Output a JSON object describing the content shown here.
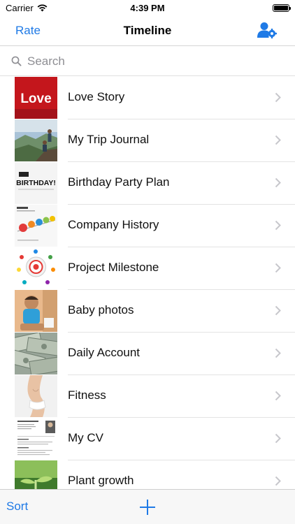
{
  "status": {
    "carrier": "Carrier",
    "time": "4:39 PM"
  },
  "nav": {
    "left_label": "Rate",
    "title": "Timeline",
    "right_icon": "user-settings-icon"
  },
  "search": {
    "placeholder": "Search"
  },
  "items": [
    {
      "label": "Love Story",
      "thumb_text": "Love"
    },
    {
      "label": "My Trip Journal"
    },
    {
      "label": "Birthday Party Plan",
      "thumb_text": "BIRTHDAY!"
    },
    {
      "label": "Company History"
    },
    {
      "label": "Project Milestone"
    },
    {
      "label": "Baby photos"
    },
    {
      "label": "Daily Account"
    },
    {
      "label": "Fitness"
    },
    {
      "label": "My CV"
    },
    {
      "label": "Plant growth"
    }
  ],
  "toolbar": {
    "sort_label": "Sort",
    "add_icon": "plus-icon"
  },
  "colors": {
    "accent": "#1f7ae6"
  }
}
